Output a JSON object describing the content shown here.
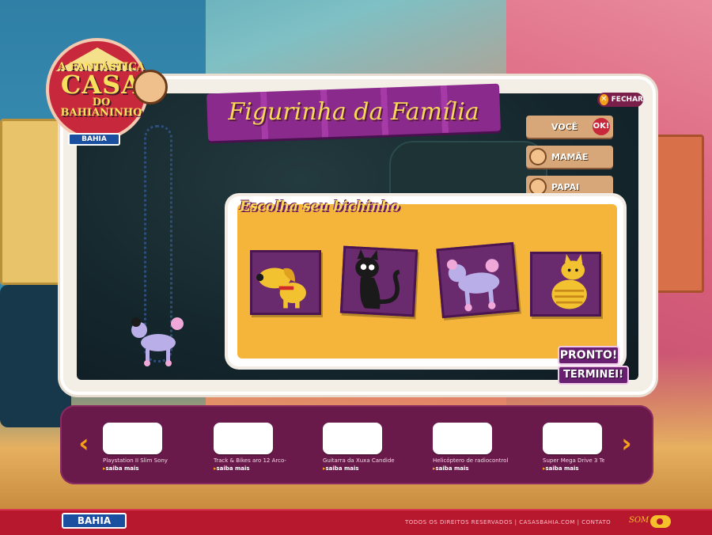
{
  "logo": {
    "line1": "A FANTÁSTICA",
    "line2": "CASA",
    "line3": "DO BAHIANINHO",
    "brand": "BAHIA"
  },
  "title": "Figurinha da Família",
  "close_button": {
    "label": "FECHAR",
    "icon": "close-icon"
  },
  "family": [
    {
      "label": "VOCÊ",
      "badge": "OK!"
    },
    {
      "label": "MAMÃE"
    },
    {
      "label": "PAPAI"
    }
  ],
  "panel": {
    "title": "Escolha seu bichinho",
    "pets": [
      {
        "name": "dog",
        "icon": "dog-icon"
      },
      {
        "name": "cat",
        "icon": "cat-icon"
      },
      {
        "name": "poodle",
        "icon": "poodle-icon"
      },
      {
        "name": "tabby-cat",
        "icon": "tabby-cat-icon"
      }
    ]
  },
  "buttons": {
    "pronto": "PRONTO!",
    "terminei": "TERMINEI!"
  },
  "carousel": {
    "prev_icon": "chevron-left-icon",
    "next_icon": "chevron-right-icon",
    "products": [
      {
        "name": "Playstation II Slim Sony",
        "more": "saiba mais"
      },
      {
        "name": "Track & Bikes aro 12 Arco-",
        "more": "saiba mais"
      },
      {
        "name": "Guitarra da Xuxa Candide",
        "more": "saiba mais"
      },
      {
        "name": "Helicóptero de radiocontrol",
        "more": "saiba mais"
      },
      {
        "name": "Super Mega Drive 3 Tec To",
        "more": "saiba mais"
      }
    ]
  },
  "footer": {
    "brand": "BAHIA",
    "links": "TODOS OS DIREITOS RESERVADOS | CASASBAHIA.COM | CONTATO",
    "sound_label": "SOM"
  },
  "colors": {
    "accent_purple": "#6a2070",
    "accent_orange": "#f5b53a",
    "footer_red": "#b8182e"
  }
}
